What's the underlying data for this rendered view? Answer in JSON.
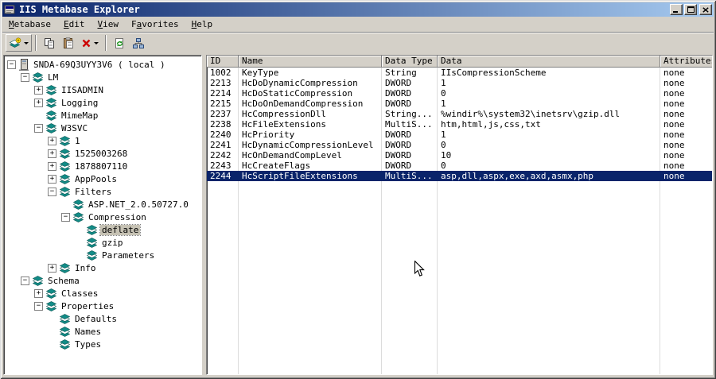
{
  "window": {
    "title": "IIS Metabase Explorer"
  },
  "menu": {
    "items": [
      {
        "label": "Metabase",
        "u": 0
      },
      {
        "label": "Edit",
        "u": 0
      },
      {
        "label": "View",
        "u": 0
      },
      {
        "label": "Favorites",
        "u": 1
      },
      {
        "label": "Help",
        "u": 0
      }
    ]
  },
  "toolbar": {
    "buttons": [
      {
        "name": "new-key",
        "icon": "new-key-icon",
        "dropdown": true,
        "raised": true
      },
      {
        "name": "separator"
      },
      {
        "name": "copy",
        "icon": "copy-icon"
      },
      {
        "name": "paste",
        "icon": "paste-icon"
      },
      {
        "name": "delete",
        "icon": "delete-icon",
        "dropdown": true
      },
      {
        "name": "separator"
      },
      {
        "name": "refresh",
        "icon": "refresh-icon"
      },
      {
        "name": "connect",
        "icon": "connect-icon"
      }
    ]
  },
  "tree": {
    "items": [
      {
        "label": "SNDA-69Q3UYY3V6 ( local )",
        "level": 0,
        "expand": "minus",
        "icon": "computer"
      },
      {
        "label": "LM",
        "level": 1,
        "expand": "minus",
        "icon": "db"
      },
      {
        "label": "IISADMIN",
        "level": 2,
        "expand": "plus",
        "icon": "db"
      },
      {
        "label": "Logging",
        "level": 2,
        "expand": "plus",
        "icon": "db"
      },
      {
        "label": "MimeMap",
        "level": 2,
        "expand": "none",
        "icon": "db"
      },
      {
        "label": "W3SVC",
        "level": 2,
        "expand": "minus",
        "icon": "db"
      },
      {
        "label": "1",
        "level": 3,
        "expand": "plus",
        "icon": "db"
      },
      {
        "label": "1525003268",
        "level": 3,
        "expand": "plus",
        "icon": "db"
      },
      {
        "label": "1878807110",
        "level": 3,
        "expand": "plus",
        "icon": "db"
      },
      {
        "label": "AppPools",
        "level": 3,
        "expand": "plus",
        "icon": "db"
      },
      {
        "label": "Filters",
        "level": 3,
        "expand": "minus",
        "icon": "db"
      },
      {
        "label": "ASP.NET_2.0.50727.0",
        "level": 4,
        "expand": "none",
        "icon": "db"
      },
      {
        "label": "Compression",
        "level": 4,
        "expand": "minus",
        "icon": "db"
      },
      {
        "label": "deflate",
        "level": 5,
        "expand": "none",
        "icon": "db",
        "selected": true
      },
      {
        "label": "gzip",
        "level": 5,
        "expand": "none",
        "icon": "db"
      },
      {
        "label": "Parameters",
        "level": 5,
        "expand": "none",
        "icon": "db"
      },
      {
        "label": "Info",
        "level": 3,
        "expand": "plus",
        "icon": "db"
      },
      {
        "label": "Schema",
        "level": 1,
        "expand": "minus",
        "icon": "db"
      },
      {
        "label": "Classes",
        "level": 2,
        "expand": "plus",
        "icon": "db"
      },
      {
        "label": "Properties",
        "level": 2,
        "expand": "minus",
        "icon": "db"
      },
      {
        "label": "Defaults",
        "level": 3,
        "expand": "none",
        "icon": "db"
      },
      {
        "label": "Names",
        "level": 3,
        "expand": "none",
        "icon": "db"
      },
      {
        "label": "Types",
        "level": 3,
        "expand": "none",
        "icon": "db"
      }
    ]
  },
  "table": {
    "columns": [
      "ID",
      "Name",
      "Data Type",
      "Data",
      "Attributes"
    ],
    "rows": [
      [
        "1002",
        "KeyType",
        "String",
        "IIsCompressionScheme",
        "none"
      ],
      [
        "2213",
        "HcDoDynamicCompression",
        "DWORD",
        "1",
        "none"
      ],
      [
        "2214",
        "HcDoStaticCompression",
        "DWORD",
        "0",
        "none"
      ],
      [
        "2215",
        "HcDoOnDemandCompression",
        "DWORD",
        "1",
        "none"
      ],
      [
        "2237",
        "HcCompressionDll",
        "String...",
        "%windir%\\system32\\inetsrv\\gzip.dll",
        "none"
      ],
      [
        "2238",
        "HcFileExtensions",
        "MultiS...",
        "htm,html,js,css,txt",
        "none"
      ],
      [
        "2240",
        "HcPriority",
        "DWORD",
        "1",
        "none"
      ],
      [
        "2241",
        "HcDynamicCompressionLevel",
        "DWORD",
        "0",
        "none"
      ],
      [
        "2242",
        "HcOnDemandCompLevel",
        "DWORD",
        "10",
        "none"
      ],
      [
        "2243",
        "HcCreateFlags",
        "DWORD",
        "0",
        "none"
      ],
      [
        "2244",
        "HcScriptFileExtensions",
        "MultiS...",
        "asp,dll,aspx,exe,axd,asmx,php",
        "none"
      ]
    ],
    "selected_id": "2244"
  },
  "colors": {
    "titlebar_start": "#0a246a",
    "titlebar_end": "#a6caf0",
    "selection": "#0a246a",
    "chrome": "#d4d0c8",
    "tree_inactive_selection": "#c6c2b4",
    "icon_teal": "#128c87"
  }
}
